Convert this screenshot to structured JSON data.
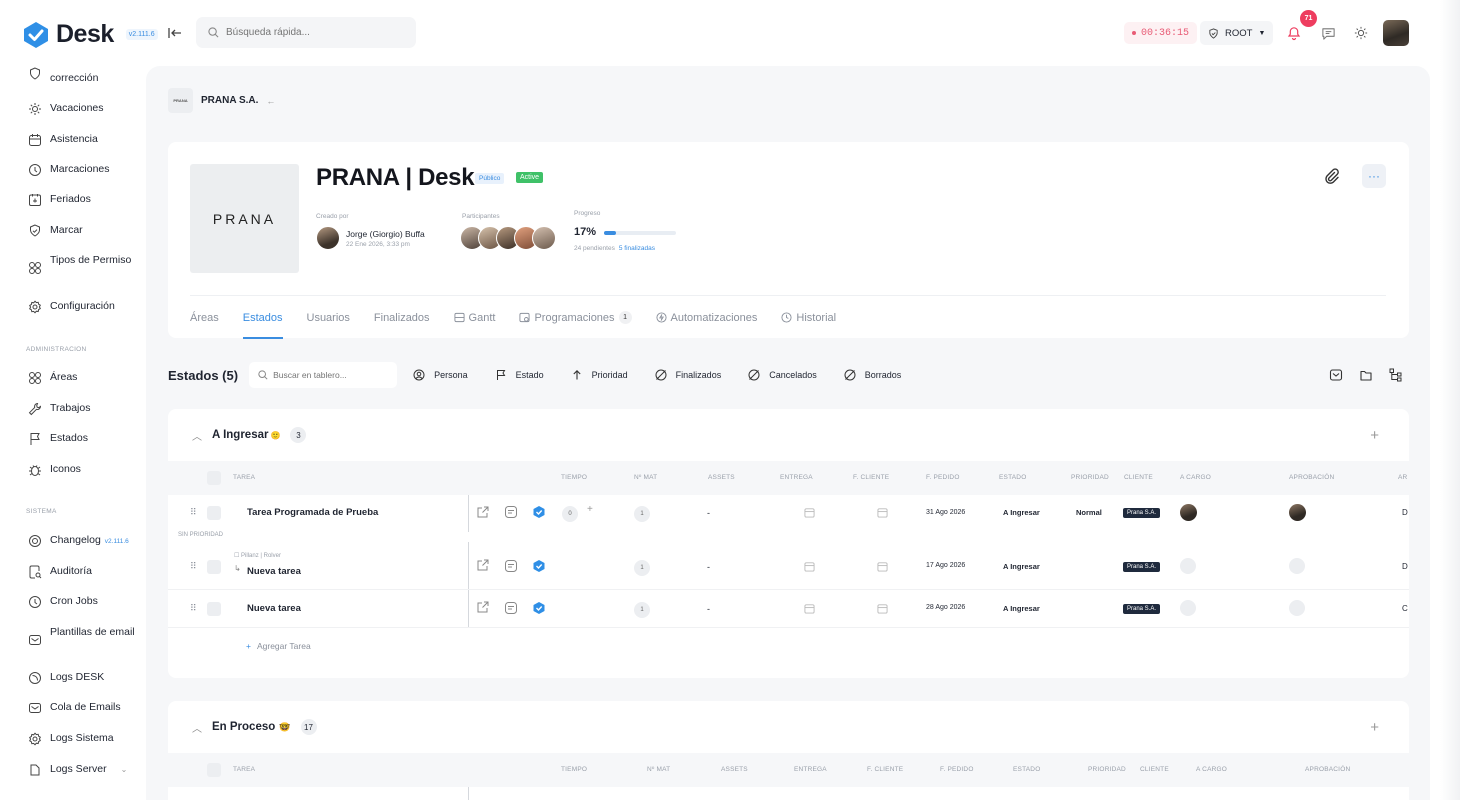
{
  "app": {
    "name": "Desk",
    "version": "v2.111.6"
  },
  "search": {
    "placeholder": "Búsqueda rápida..."
  },
  "header": {
    "timer": "00:36:15",
    "role": "ROOT",
    "notifications": "71"
  },
  "sidebar": {
    "items": [
      {
        "label": "corrección",
        "icon": "shield-alert-icon"
      },
      {
        "label": "Vacaciones",
        "icon": "sun-icon"
      },
      {
        "label": "Asistencia",
        "icon": "calendar-icon"
      },
      {
        "label": "Marcaciones",
        "icon": "clock-icon"
      },
      {
        "label": "Feriados",
        "icon": "calendar-star-icon"
      },
      {
        "label": "Marcar",
        "icon": "shield-check-icon"
      },
      {
        "label": "Tipos de Permiso",
        "icon": "grid-icon"
      },
      {
        "label": "Configuración",
        "icon": "gear-icon"
      }
    ],
    "admin_label": "ADMINISTRACION",
    "admin_items": [
      {
        "label": "Áreas",
        "icon": "grid-icon"
      },
      {
        "label": "Trabajos",
        "icon": "wrench-icon"
      },
      {
        "label": "Estados",
        "icon": "flag-icon"
      },
      {
        "label": "Iconos",
        "icon": "bug-icon"
      }
    ],
    "system_label": "SISTEMA",
    "system_items": [
      {
        "label": "Changelog",
        "badge": "v2.111.6",
        "icon": "history-icon"
      },
      {
        "label": "Auditoría",
        "icon": "search-doc-icon"
      },
      {
        "label": "Cron Jobs",
        "icon": "clock-icon"
      },
      {
        "label": "Plantillas de email",
        "icon": "mail-icon"
      },
      {
        "label": "Logs DESK",
        "icon": "log-icon"
      },
      {
        "label": "Cola de Emails",
        "icon": "mail-icon"
      },
      {
        "label": "Logs Sistema",
        "icon": "gear-icon"
      },
      {
        "label": "Logs Server",
        "icon": "server-icon"
      }
    ]
  },
  "breadcrumb": {
    "name": "PRANA S.A.",
    "logo_text": "PRANA"
  },
  "project": {
    "logo_text": "PRANA",
    "title": "PRANA | Desk",
    "visibility": "Público",
    "status": "Active",
    "created_by_label": "Creado por",
    "creator_name": "Jorge (Giorgio) Buffa",
    "creator_date": "22 Ene 2026, 3:33 pm",
    "participants_label": "Participantes",
    "progress_label": "Progreso",
    "progress_value": "17%",
    "progress_fraction": 0.17,
    "pending": "24 pendientes",
    "finished": "5 finalizadas"
  },
  "tabs": [
    {
      "label": "Áreas"
    },
    {
      "label": "Estados"
    },
    {
      "label": "Usuarios"
    },
    {
      "label": "Finalizados"
    },
    {
      "label": "Gantt"
    },
    {
      "label": "Programaciones",
      "count": "1"
    },
    {
      "label": "Automatizaciones"
    },
    {
      "label": "Historial"
    }
  ],
  "toolbar": {
    "title": "Estados (5)",
    "search_placeholder": "Buscar en tablero...",
    "filters": [
      "Persona",
      "Estado",
      "Prioridad",
      "Finalizados",
      "Cancelados",
      "Borrados"
    ]
  },
  "columns": [
    "TAREA",
    "TIEMPO",
    "Nº MAT",
    "ASSETS",
    "ENTREGA",
    "F. CLIENTE",
    "F. PEDIDO",
    "ESTADO",
    "PRIORIDAD",
    "CLIENTE",
    "A CARGO",
    "APROBACIÓN",
    "AR"
  ],
  "groups": [
    {
      "name": "A Ingresar",
      "count": "3",
      "no_priority_label": "SIN PRIORIDAD",
      "add_label": "Agregar Tarea",
      "tasks": [
        {
          "name": "Tarea Programada de Prueba",
          "time": "0",
          "mat": "1",
          "assets": "-",
          "f_pedido": "31 Ago 2026",
          "estado": "A Ingresar",
          "prioridad": "Normal",
          "cliente": "Prana S.A.",
          "extra": "D"
        },
        {
          "parent": "Pillanz | Rolver",
          "name": "Nueva tarea",
          "mat": "1",
          "assets": "-",
          "f_pedido": "17 Ago 2026",
          "estado": "A Ingresar",
          "cliente": "Prana S.A.",
          "extra": "D"
        },
        {
          "name": "Nueva tarea",
          "mat": "1",
          "assets": "-",
          "f_pedido": "28 Ago 2026",
          "estado": "A Ingresar",
          "cliente": "Prana S.A.",
          "extra": "C"
        }
      ]
    },
    {
      "name": "En Proceso",
      "count": "17"
    }
  ],
  "colors": {
    "accent": "#3a8de0",
    "active": "#3fc168",
    "alert": "#ee3d5f"
  }
}
